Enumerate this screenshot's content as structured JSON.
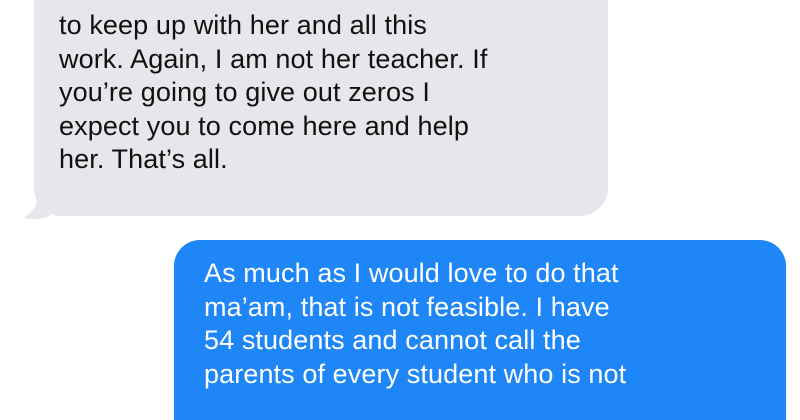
{
  "colors": {
    "received_bubble": "#e6e6eb",
    "received_text": "#111111",
    "sent_bubble": "#1e86f6",
    "sent_text": "#ffffff",
    "background": "#ffffff"
  },
  "conversation": {
    "received_message": {
      "lines": [
        "to keep up with her and all this",
        "work. Again, I am not her teacher. If",
        "you’re going to give out zeros I",
        "expect you to come here and help",
        "her. That’s all."
      ]
    },
    "sent_message": {
      "lines": [
        "As much as I would love to do that",
        "ma’am, that is not feasible. I have",
        "54 students and cannot call the",
        "parents of every student who is not"
      ]
    }
  }
}
